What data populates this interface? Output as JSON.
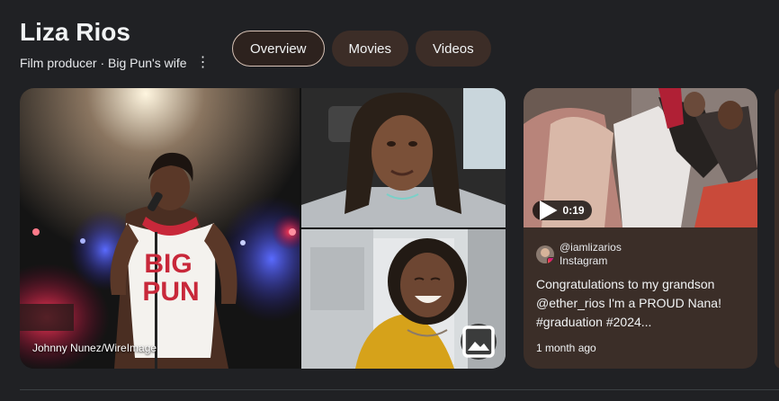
{
  "header": {
    "title": "Liza Rios",
    "subtitle": "Film producer · Big Pun's wife",
    "more_icon": "kebab-menu-icon"
  },
  "tabs": [
    {
      "label": "Overview",
      "active": true
    },
    {
      "label": "Movies",
      "active": false
    },
    {
      "label": "Videos",
      "active": false
    }
  ],
  "gallery": {
    "main_photo_credit": "Johnny Nunez/WireImage",
    "shirt_text_line1": "BIG",
    "shirt_text_line2": "PUN",
    "images_icon": "image-icon"
  },
  "video_card": {
    "duration": "0:19",
    "account": "@iamlizarios",
    "platform": "Instagram",
    "caption": "Congratulations to my grandson @ether_rios I'm a PROUD Nana! #graduation #2024...",
    "posted": "1 month ago",
    "play_icon": "play-icon",
    "platform_icon": "instagram-icon"
  },
  "colors": {
    "background": "#202124",
    "tab_bg": "#3c2d27",
    "card_bg": "#3b2e28",
    "text": "#e8eaed"
  }
}
